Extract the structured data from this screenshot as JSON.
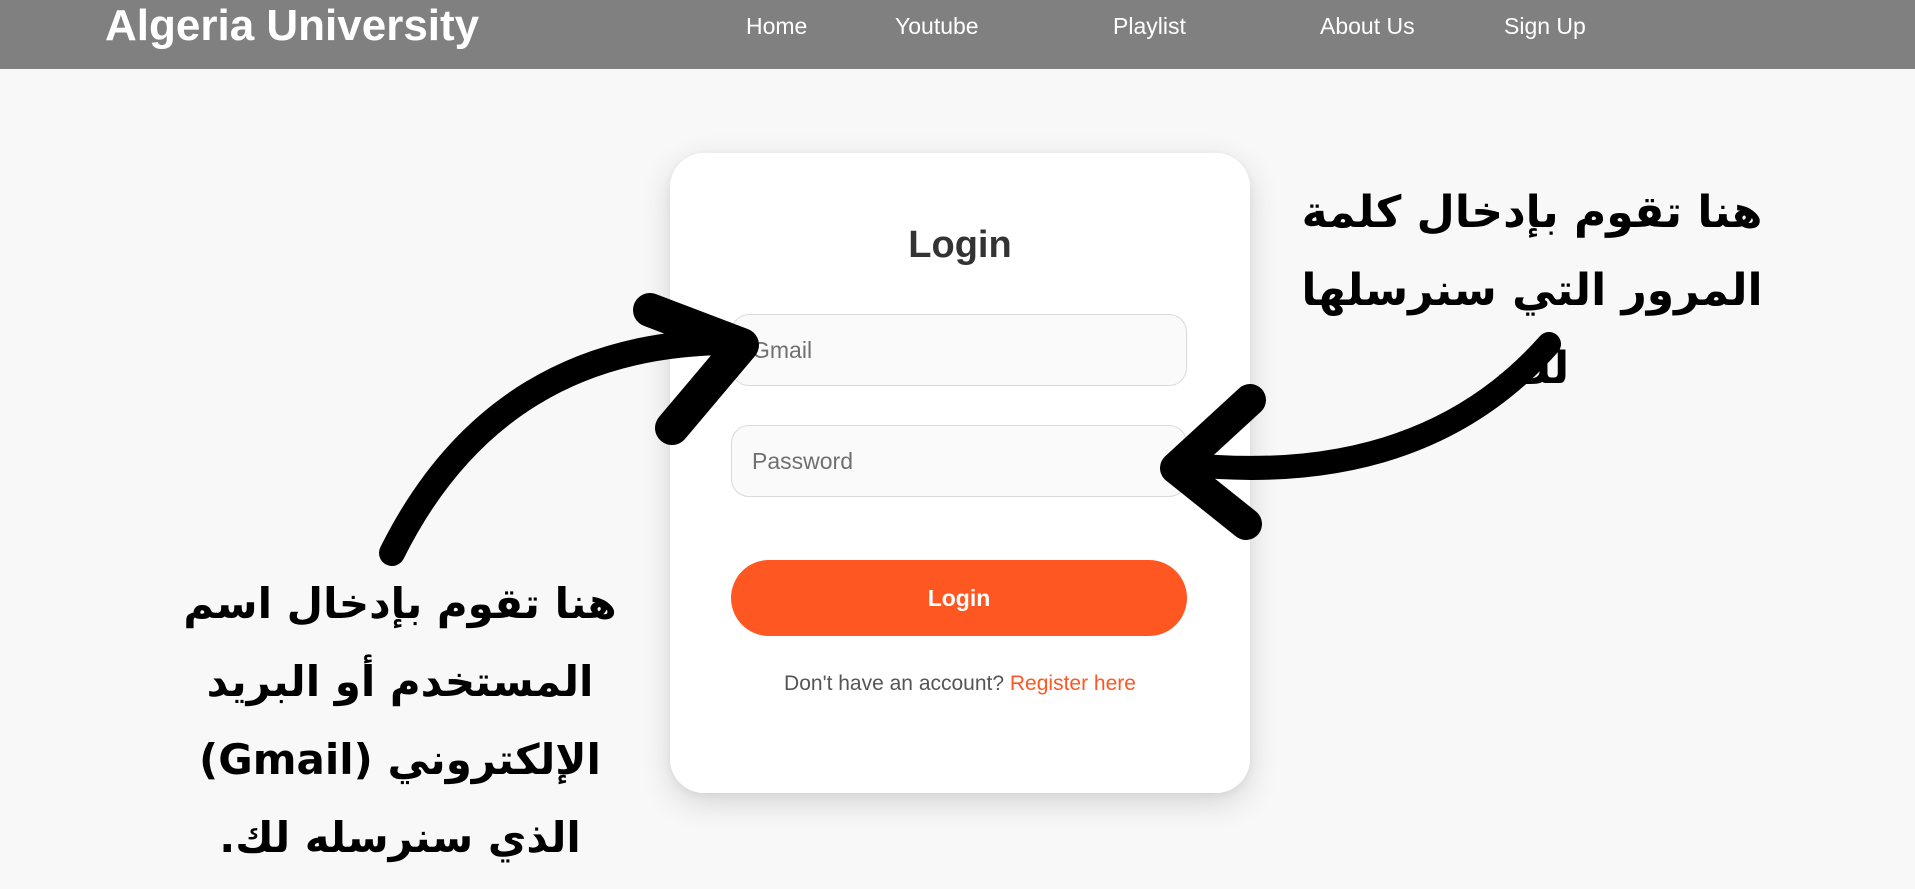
{
  "navbar": {
    "brand": "Algeria University",
    "links": [
      "Home",
      "Youtube",
      "Playlist",
      "About Us",
      "Sign Up"
    ]
  },
  "login_card": {
    "title": "Login",
    "gmail_placeholder": "Gmail",
    "password_placeholder": "Password",
    "submit_label": "Login",
    "register_prompt": "Don't have an account?",
    "register_link": "Register here"
  },
  "annotations": {
    "password_note": "هنا تقوم بإدخال كلمة المرور التي سنرسلها لك.",
    "gmail_note": "هنا تقوم بإدخال اسم المستخدم أو البريد الإلكتروني (Gmail) الذي سنرسله لك."
  },
  "colors": {
    "navbar_bg": "#808080",
    "page_bg": "#f8f8f8",
    "accent": "#ff5722",
    "arrow": "#000000"
  }
}
